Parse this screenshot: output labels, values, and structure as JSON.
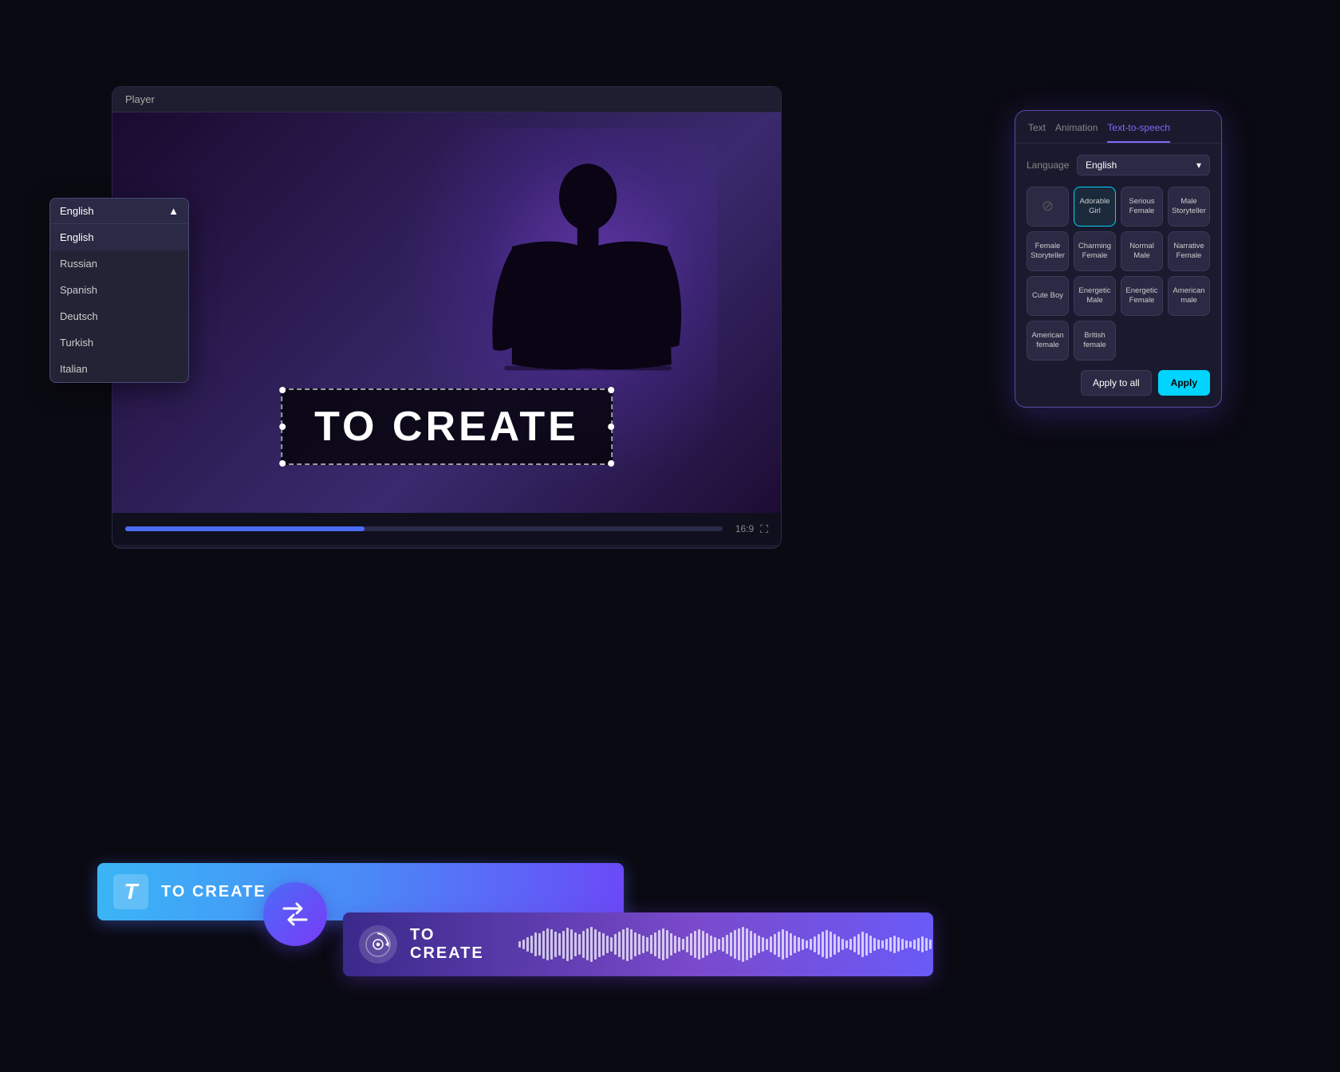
{
  "player": {
    "title": "Player",
    "text_overlay": "TO CREATE",
    "aspect_ratio": "16:9",
    "timeline_percent": 40
  },
  "lang_dropdown": {
    "selected": "English",
    "items": [
      "English",
      "Russian",
      "Spanish",
      "Deutsch",
      "Turkish",
      "Italian"
    ]
  },
  "tts_panel": {
    "tabs": [
      "Text",
      "Animation",
      "Text-to-speech"
    ],
    "active_tab": "Text-to-speech",
    "language_label": "Language",
    "language_value": "English",
    "voices": [
      {
        "label": "",
        "type": "mute",
        "selected": false
      },
      {
        "label": "Adorable Girl",
        "type": "voice",
        "selected": true
      },
      {
        "label": "Serious Female",
        "type": "voice",
        "selected": false
      },
      {
        "label": "Male Storyteller",
        "type": "voice",
        "selected": false
      },
      {
        "label": "Female Storyteller",
        "type": "voice",
        "selected": false
      },
      {
        "label": "Charming Female",
        "type": "voice",
        "selected": false
      },
      {
        "label": "Normal Male",
        "type": "voice",
        "selected": false
      },
      {
        "label": "Narrative Female",
        "type": "voice",
        "selected": false
      },
      {
        "label": "Cute Boy",
        "type": "voice",
        "selected": false
      },
      {
        "label": "Energetic Male",
        "type": "voice",
        "selected": false
      },
      {
        "label": "Energetic Female",
        "type": "voice",
        "selected": false
      },
      {
        "label": "American male",
        "type": "voice",
        "selected": false
      },
      {
        "label": "American female",
        "type": "voice",
        "selected": false
      },
      {
        "label": "British female",
        "type": "voice",
        "selected": false
      },
      {
        "label": "",
        "type": "empty",
        "selected": false
      },
      {
        "label": "",
        "type": "empty",
        "selected": false
      }
    ],
    "btn_apply_all": "Apply to all",
    "btn_apply": "Apply"
  },
  "text_track": {
    "icon": "T",
    "label": "TO CREATE"
  },
  "audio_track": {
    "label": "TO CREATE"
  }
}
